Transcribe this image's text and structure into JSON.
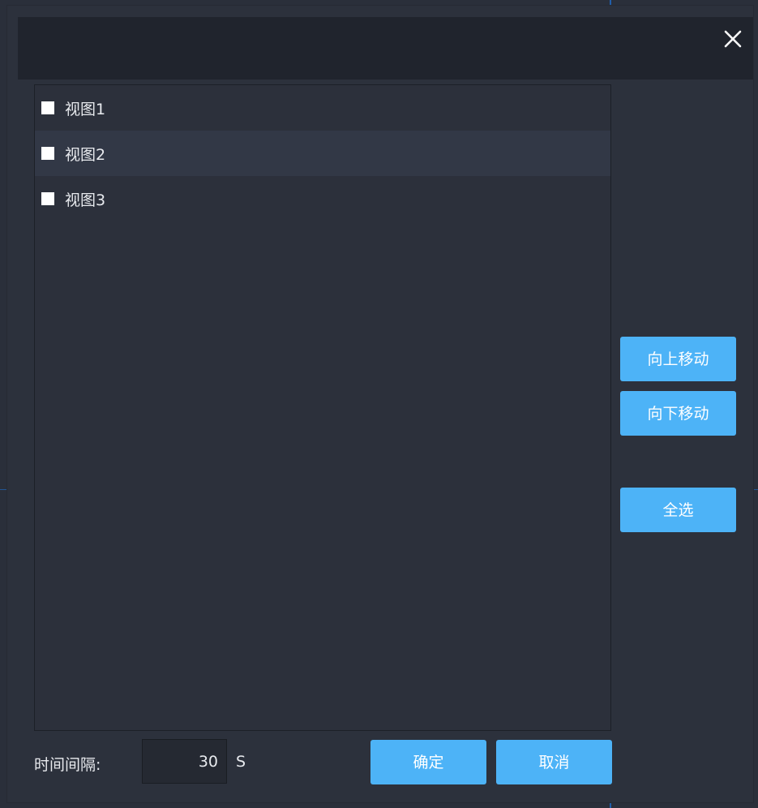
{
  "dialog": {
    "close_icon": "close-icon"
  },
  "list": {
    "items": [
      {
        "label": "视图1",
        "checked": false
      },
      {
        "label": "视图2",
        "checked": false
      },
      {
        "label": "视图3",
        "checked": false
      }
    ]
  },
  "side_actions": {
    "move_up_label": "向上移动",
    "move_down_label": "向下移动",
    "select_all_label": "全选"
  },
  "footer": {
    "interval_label": "时间间隔:",
    "interval_value": "30",
    "interval_unit": "S",
    "confirm_label": "确定",
    "cancel_label": "取消"
  },
  "colors": {
    "accent": "#4db3f7",
    "dialog_bg": "#2c313c",
    "titlebar_bg": "#20242d",
    "text": "#e8eaee"
  }
}
